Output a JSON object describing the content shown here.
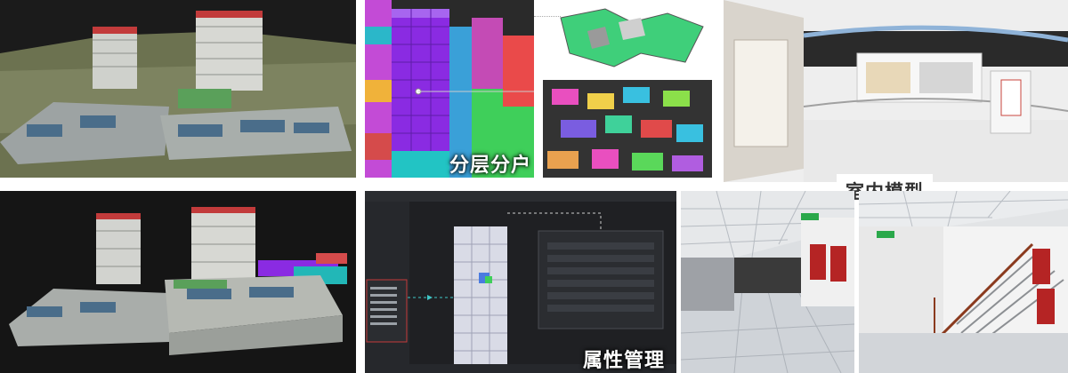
{
  "captions": {
    "layered": "分层分户",
    "indoor": "室内模型",
    "attribute": "属性管理"
  },
  "colors": {
    "panel_dark": "#151515",
    "layer_purple": "#8a2be2",
    "layer_green": "#3fcf5a",
    "layer_cyan": "#22c4c4",
    "ui_dark": "#2b2d31",
    "poster_red": "#b52424",
    "exit_sign": "#2aa84a"
  },
  "icons": {
    "attribute_link": "dotted-arrow-icon",
    "detail_link": "dotted-connector-icon"
  }
}
